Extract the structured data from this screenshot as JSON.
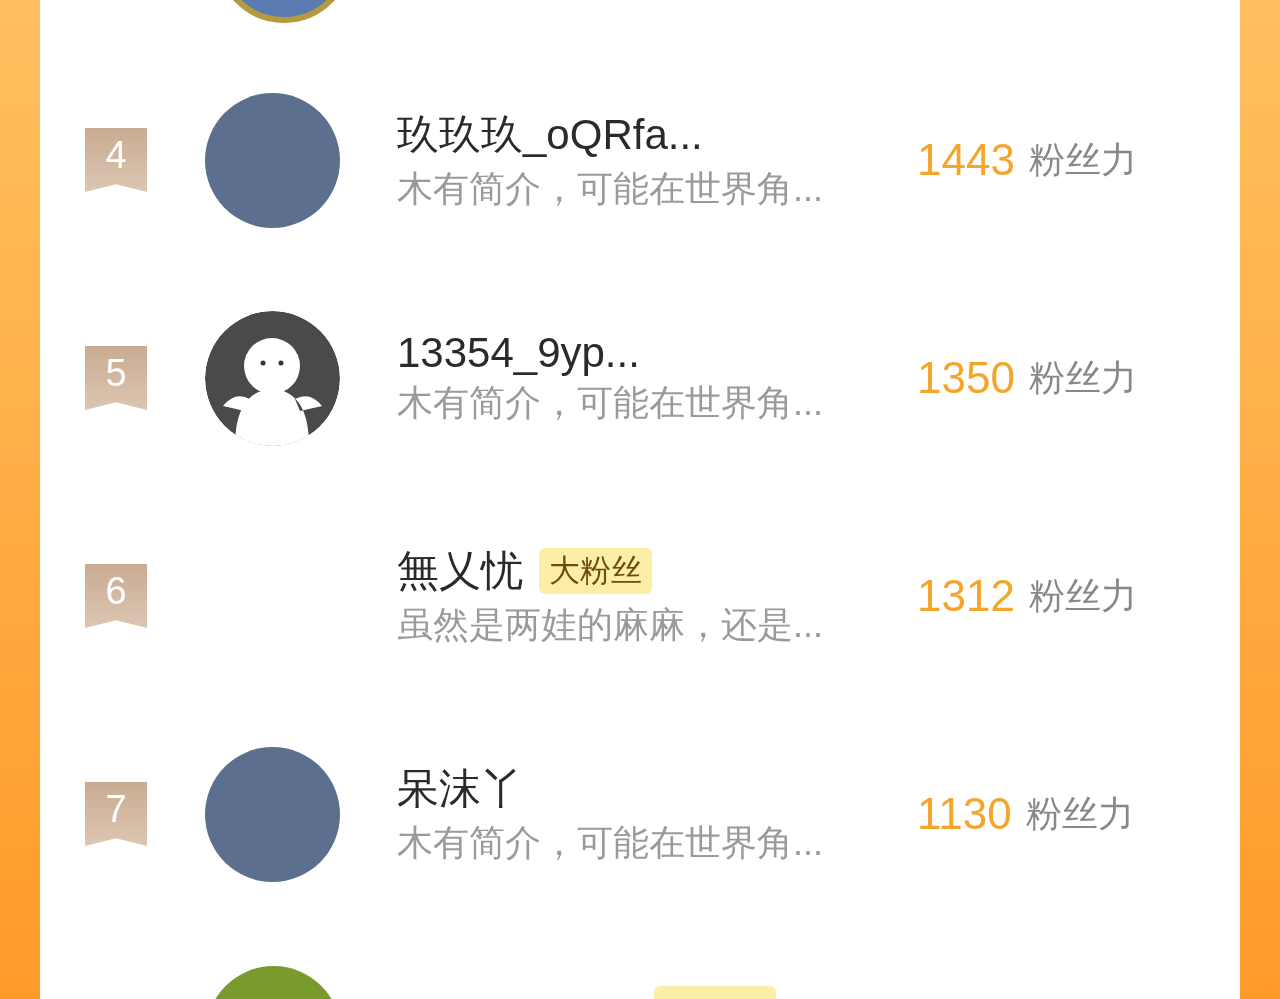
{
  "rows": [
    {
      "rank": "4",
      "avatar": {
        "kind": "photo"
      },
      "name": "玖玖玖_oQRfa...",
      "bio": "木有简介，可能在世界角...",
      "score": "1443",
      "unit": "粉丝力"
    },
    {
      "rank": "5",
      "avatar": {
        "kind": "default"
      },
      "name": "13354_9yp...",
      "bio": "木有简介，可能在世界角...",
      "score": "1350",
      "unit": "粉丝力"
    },
    {
      "rank": "6",
      "avatar": {
        "kind": "none"
      },
      "name": "無乂忧",
      "tag": "大粉丝",
      "bio": "虽然是两娃的麻麻，还是...",
      "score": "1312",
      "unit": "粉丝力"
    },
    {
      "rank": "7",
      "avatar": {
        "kind": "photo"
      },
      "name": "呆沫丫",
      "bio": "木有简介，可能在世界角...",
      "score": "1130",
      "unit": "粉丝力"
    }
  ]
}
